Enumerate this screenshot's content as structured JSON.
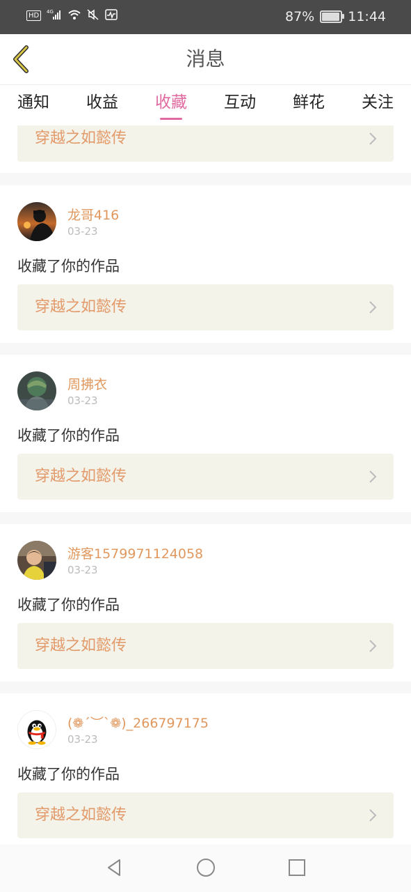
{
  "status_bar": {
    "hd": "HD",
    "network": "4G",
    "battery_percent": "87%",
    "battery_level": 0.87,
    "time": "11:44"
  },
  "header": {
    "title": "消息"
  },
  "tabs": [
    {
      "label": "通知",
      "active": false
    },
    {
      "label": "收益",
      "active": false
    },
    {
      "label": "收藏",
      "active": true
    },
    {
      "label": "互动",
      "active": false
    },
    {
      "label": "鲜花",
      "active": false
    },
    {
      "label": "关注",
      "active": false
    }
  ],
  "partial_item": {
    "work_title": "穿越之如懿传"
  },
  "items": [
    {
      "username": "龙哥416",
      "date": "03-23",
      "action": "收藏了你的作品",
      "work_title": "穿越之如懿传"
    },
    {
      "username": "周拂衣",
      "date": "03-23",
      "action": "收藏了你的作品",
      "work_title": "穿越之如懿传"
    },
    {
      "username": "游客1579971124058",
      "date": "03-23",
      "action": "收藏了你的作品",
      "work_title": "穿越之如懿传"
    },
    {
      "username": "(❁´︶`❁)_266797175",
      "date": "03-23",
      "action": "收藏了你的作品",
      "work_title": "穿越之如懿传"
    }
  ],
  "colors": {
    "accent_pink": "#e06aa0",
    "username_orange": "#e0985e",
    "work_title_orange": "#e39a6a",
    "work_box_bg": "#f4f3ea",
    "back_arrow": "#c9b23a"
  }
}
